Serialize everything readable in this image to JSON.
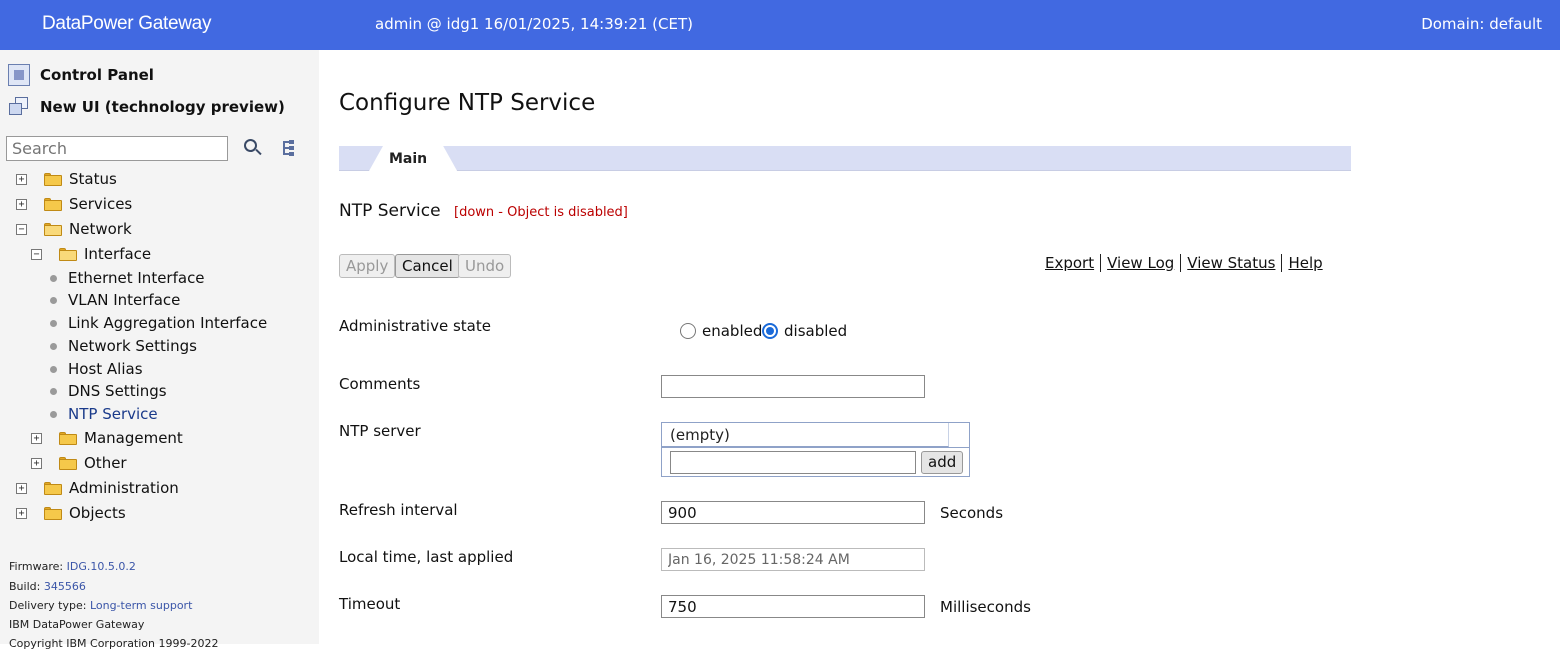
{
  "header": {
    "brand": "DataPower Gateway",
    "session": "admin @ idg1 16/01/2025, 14:39:21 (CET)",
    "domain": "Domain: default"
  },
  "sidebar": {
    "control_panel": "Control Panel",
    "new_ui": "New UI (technology preview)",
    "search_placeholder": "Search",
    "tree": {
      "status": "Status",
      "services": "Services",
      "network": "Network",
      "interface": "Interface",
      "leaves": [
        "Ethernet Interface",
        "VLAN Interface",
        "Link Aggregation Interface",
        "Network Settings",
        "Host Alias",
        "DNS Settings",
        "NTP Service"
      ],
      "management": "Management",
      "other": "Other",
      "administration": "Administration",
      "objects": "Objects"
    },
    "footer": {
      "firmware_label": "Firmware:",
      "firmware": "IDG.10.5.0.2",
      "build_label": "Build:",
      "build": "345566",
      "delivery_label": "Delivery type:",
      "delivery": "Long-term support",
      "product": "IBM DataPower Gateway",
      "copyright": "Copyright IBM Corporation 1999-2022"
    }
  },
  "main": {
    "title": "Configure NTP Service",
    "tab": "Main",
    "object_name": "NTP Service",
    "object_status": "[down - Object is disabled]",
    "buttons": {
      "apply": "Apply",
      "cancel": "Cancel",
      "undo": "Undo"
    },
    "links": [
      "Export",
      "View Log",
      "View Status",
      "Help"
    ],
    "form": {
      "admin_state_label": "Administrative state",
      "enabled": "enabled",
      "disabled": "disabled",
      "admin_state_value": "disabled",
      "comments_label": "Comments",
      "comments_value": "",
      "ntp_server_label": "NTP server",
      "ntp_server_empty": "(empty)",
      "add_label": "add",
      "refresh_label": "Refresh interval",
      "refresh_value": "900",
      "refresh_unit": "Seconds",
      "local_time_label": "Local time, last applied",
      "local_time_value": "Jan 16, 2025 11:58:24 AM",
      "timeout_label": "Timeout",
      "timeout_value": "750",
      "timeout_unit": "Milliseconds"
    }
  },
  "colors": {
    "header_bg": "#4169e1",
    "tab_strip": "#d9def4",
    "status_red": "#bb0000"
  }
}
